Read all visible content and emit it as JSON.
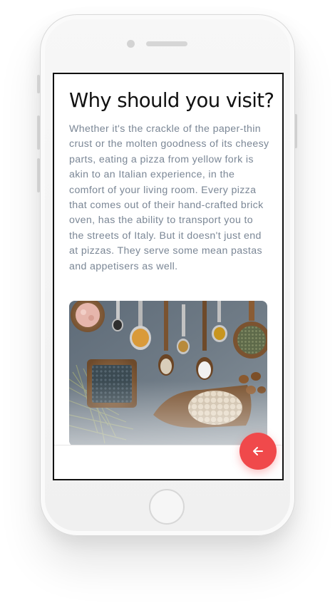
{
  "article": {
    "title": "Why should you visit?",
    "body": "Whether it's the crackle of the paper-thin crust or the molten goodness of its cheesy parts, eating a pizza from yellow fork is akin to an Italian experience, in the comfort of your living room. Every pizza that comes out of their hand-crafted brick oven, has the ability to transport you to the streets of Italy. But it doesn't just end at pizzas. They serve some mean pastas and appetisers as well."
  },
  "icons": {
    "back": "arrow-left-icon",
    "hero": "spices-photo"
  },
  "colors": {
    "fab": "#f0494b",
    "title": "#111111",
    "body": "#7b8796"
  }
}
